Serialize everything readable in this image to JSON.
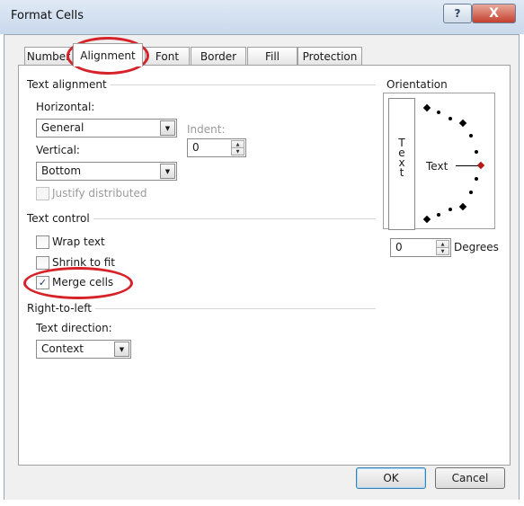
{
  "window": {
    "title": "Format Cells",
    "help_label": "?",
    "close_label": "X"
  },
  "tabs": [
    "Number",
    "Alignment",
    "Font",
    "Border",
    "Fill",
    "Protection"
  ],
  "active_tab": "Alignment",
  "text_alignment": {
    "section_label": "Text alignment",
    "horizontal_label": "Horizontal:",
    "horizontal_value": "General",
    "indent_label": "Indent:",
    "indent_value": "0",
    "vertical_label": "Vertical:",
    "vertical_value": "Bottom",
    "justify_distributed_label": "Justify distributed",
    "justify_distributed_enabled": false
  },
  "text_control": {
    "section_label": "Text control",
    "wrap_text_label": "Wrap text",
    "wrap_text_checked": false,
    "shrink_to_fit_label": "Shrink to fit",
    "shrink_to_fit_checked": false,
    "merge_cells_label": "Merge cells",
    "merge_cells_checked": true,
    "check_glyph": "✓"
  },
  "right_to_left": {
    "section_label": "Right-to-left",
    "text_direction_label": "Text direction:",
    "text_direction_value": "Context"
  },
  "orientation": {
    "section_label": "Orientation",
    "vertical_text_letters": [
      "T",
      "e",
      "x",
      "t"
    ],
    "dial_text": "Text",
    "degrees_value": "0",
    "degrees_label": "Degrees",
    "angle_degrees": 0
  },
  "buttons": {
    "ok": "OK",
    "cancel": "Cancel"
  },
  "icons": {
    "dropdown_arrow": "▼",
    "spin_up": "▲",
    "spin_down": "▼"
  },
  "colors": {
    "annotation_ring": "#d6232a",
    "dial_indicator": "#b01c1c"
  }
}
